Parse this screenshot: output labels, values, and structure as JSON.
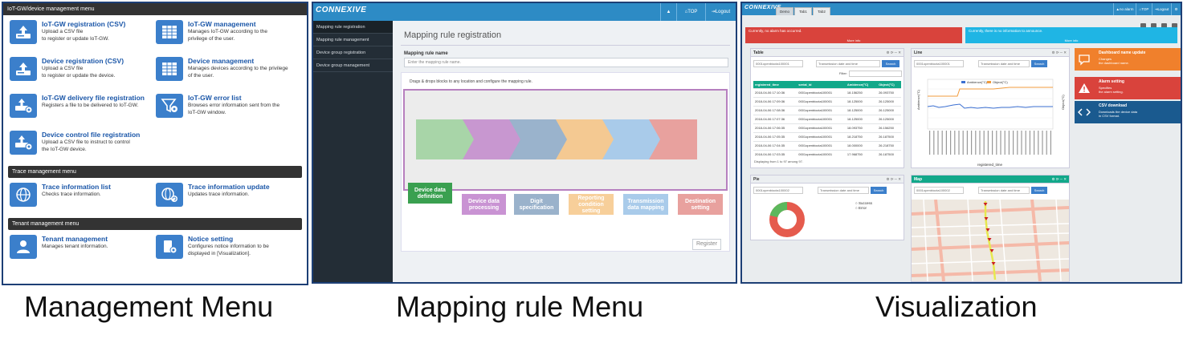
{
  "management": {
    "sections": [
      {
        "title": "IoT-GW/device management menu",
        "items": [
          {
            "title": "IoT-GW registration (CSV)",
            "lines": [
              "Upload a CSV file",
              "to register or update IoT-GW."
            ],
            "icon": "upload-csv-icon"
          },
          {
            "title": "IoT-GW management",
            "lines": [
              "Manages IoT-GW according to the",
              "privilege of the user."
            ],
            "icon": "grid-table-icon"
          },
          {
            "title": "Device registration (CSV)",
            "lines": [
              "Upload a CSV file",
              "to register or update the device."
            ],
            "icon": "upload-csv-icon"
          },
          {
            "title": "Device management",
            "lines": [
              "Manages devices according to the privilege",
              "of the user."
            ],
            "icon": "grid-table-icon"
          },
          {
            "title": "IoT-GW delivery file registration",
            "lines": [
              "Registers a file to be delivered to IoT-GW."
            ],
            "icon": "upload-gear-icon"
          },
          {
            "title": "IoT-GW error list",
            "lines": [
              "Browses error information sent from the",
              "IoT-GW window."
            ],
            "icon": "funnel-gear-icon"
          },
          {
            "title": "Device control file registration",
            "lines": [
              "Upload a CSV file to instruct to control",
              "the IoT-GW device."
            ],
            "icon": "upload-gear-icon"
          }
        ]
      },
      {
        "title": "Trace management menu",
        "items": [
          {
            "title": "Trace information list",
            "lines": [
              "Checks trace information."
            ],
            "icon": "globe-icon"
          },
          {
            "title": "Trace information update",
            "lines": [
              "Updates trace information."
            ],
            "icon": "globe-refresh-icon"
          }
        ]
      },
      {
        "title": "Tenant management menu",
        "items": [
          {
            "title": "Tenant management",
            "lines": [
              "Manages tenant information."
            ],
            "icon": "user-icon"
          },
          {
            "title": "Notice setting",
            "lines": [
              "Configures notice information to be",
              "displayed in [Visualization]."
            ],
            "icon": "notice-gear-icon"
          }
        ]
      }
    ]
  },
  "mapping": {
    "logo": "CONNEXIVE",
    "topbar": {
      "alert_icon": "▲",
      "top_label": "TOP",
      "logout_label": "Logout"
    },
    "sidebar": [
      "Mapping rule registration",
      "Mapping rule management",
      "Device group registration",
      "Device group management"
    ],
    "page_title": "Mapping rule registration",
    "field_label": "Mapping rule name",
    "field_placeholder": "Enter the mapping rule name.",
    "hint": "Drags & drops blocks to any location and configure the mapping rule.",
    "arrow_colors": [
      "#a8d5a8",
      "#c897d0",
      "#9ab3cc",
      "#f4c992",
      "#a9cbea",
      "#e8a19e"
    ],
    "blocks": [
      {
        "label": "Device data definition",
        "color": "#3aa050"
      },
      {
        "label": "Device data processing",
        "color": "#c993d3"
      },
      {
        "label": "Digit specification",
        "color": "#9ab2cb"
      },
      {
        "label": "Reporting condition setting",
        "color": "#f7cf9a"
      },
      {
        "label": "Transmission data mapping",
        "color": "#a9cbea"
      },
      {
        "label": "Destination setting",
        "color": "#e8a19e"
      }
    ],
    "register_label": "Register"
  },
  "visualization": {
    "logo": "CONNEXIVE",
    "tabs": [
      "Demo",
      "Tab1",
      "Tab2"
    ],
    "topbar": {
      "no_alarm": "no alarm",
      "top_label": "TOP",
      "logout_label": "Logout"
    },
    "alerts": [
      {
        "text": "Currently, no alarm has occurred.",
        "more": "More info",
        "color": "#d9433c"
      },
      {
        "text": "Currently, there is no information to announce.",
        "more": "More info",
        "color": "#1fb5e4"
      }
    ],
    "table_widget": {
      "title": "Table",
      "device_id": "0001openbiocta100001",
      "date_placeholder": "Transmission date and time",
      "search": "Search",
      "filter_label": "Filter:",
      "columns": [
        "registered_time",
        "serial_id",
        "Ambience(°C)",
        "Object(°C)"
      ],
      "rows": [
        [
          "2018-04-06 17:10:36",
          "0001openbiocta100001",
          "18.156250",
          "26.093750"
        ],
        [
          "2018-04-06 17:09:36",
          "0001openbiocta100001",
          "18.125000",
          "26.125000"
        ],
        [
          "2018-04-06 17:08:36",
          "0001openbiocta100001",
          "18.125000",
          "26.125000"
        ],
        [
          "2018-04-06 17:07:36",
          "0001openbiocta100001",
          "18.125000",
          "26.125000"
        ],
        [
          "2018-04-06 17:06:35",
          "0001openbiocta100001",
          "18.093750",
          "26.156250"
        ],
        [
          "2018-04-06 17:05:35",
          "0001openbiocta100001",
          "18.218750",
          "26.187500"
        ],
        [
          "2018-04-06 17:04:35",
          "0001openbiocta100001",
          "18.000000",
          "26.218750"
        ],
        [
          "2018-04-06 17:03:35",
          "0001openbiocta100001",
          "17.968750",
          "26.187500"
        ]
      ],
      "footer": "Displaying from 1 to 97 among 97."
    },
    "line_widget": {
      "title": "Line",
      "device_id": "0001openbiocta100001",
      "date_placeholder": "Transmission date and time",
      "search": "Search",
      "legend": [
        "Ambience(°C)",
        "Object(°C)"
      ],
      "y_left_label": "Ambience(°C)",
      "y_right_label": "Object(°C)",
      "x_label": "registered_time"
    },
    "pie_widget": {
      "title": "Pie",
      "device_id": "0001openbiocta100002",
      "date_placeholder": "Transmission date and time",
      "search": "Search",
      "legend": [
        "Success",
        "Error"
      ]
    },
    "map_widget": {
      "title": "Map",
      "device_id": "0001openbiocta100002",
      "date_placeholder": "Transmission date and time",
      "search": "Search"
    },
    "dashboard_items": [
      {
        "title": "Dashboard name update",
        "desc": [
          "Changes",
          "the dashboard name."
        ],
        "color": "#f0802c",
        "icon": "chat-icon"
      },
      {
        "title": "Alarm setting",
        "desc": [
          "Specifies",
          "the alarm setting."
        ],
        "color": "#d9433c",
        "icon": "warning-icon"
      },
      {
        "title": "CSV download",
        "desc": [
          "Downloads the device data",
          "in CSV format."
        ],
        "color": "#1a5a8f",
        "icon": "code-icon"
      }
    ]
  },
  "captions": [
    "Management Menu",
    "Mapping rule Menu",
    "Visualization"
  ]
}
